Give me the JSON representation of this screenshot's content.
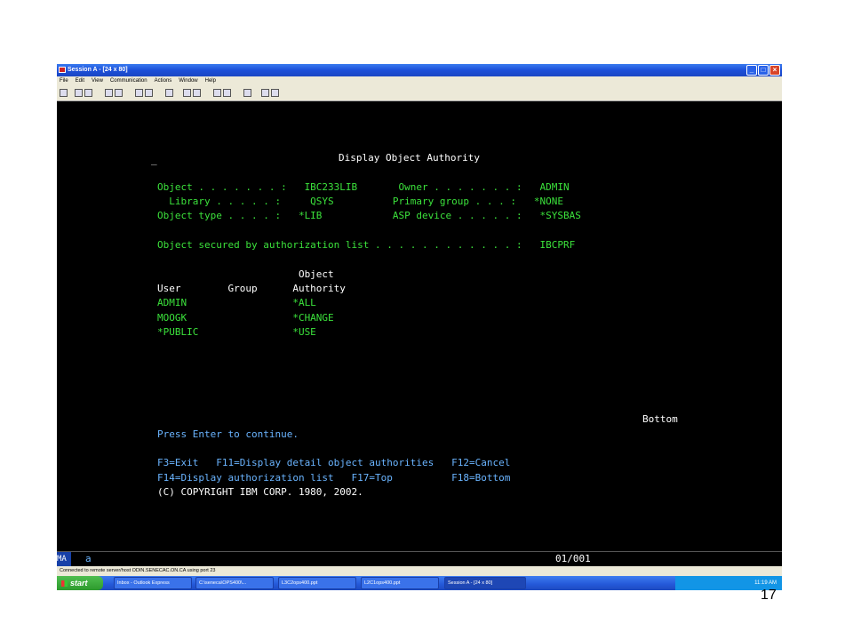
{
  "window": {
    "title": "Session A - [24 x 80]",
    "controls": [
      "minimize",
      "maximize",
      "close"
    ]
  },
  "menu": [
    "File",
    "Edit",
    "View",
    "Communication",
    "Actions",
    "Window",
    "Help"
  ],
  "toolbar_icons": [
    "print-screen-icon",
    "copy-icon",
    "paste-icon",
    "send-icon",
    "receive-icon",
    "display-icon",
    "keyboard-icon",
    "macro-icon",
    "record-icon",
    "play-icon",
    "stop-icon",
    "color-icon",
    "support-icon",
    "cursor-icon",
    "clear-icon"
  ],
  "terminal": {
    "cursor": "_",
    "heading": "Display Object Authority",
    "line_object": "Object . . . . . . . :   IBC233LIB       Owner . . . . . . . :   ADMIN",
    "line_library": "  Library . . . . . :     QSYS          Primary group . . . :   *NONE",
    "line_objtype": "Object type . . . . :   *LIB            ASP device . . . . . :   *SYSBAS",
    "line_secured": "Object secured by authorization list . . . . . . . . . . . . :   IBCPRF",
    "col_header1": "                        Object",
    "col_header2": "User        Group      Authority",
    "rows": [
      "ADMIN                  *ALL",
      "MOOGK                  *CHANGE",
      "*PUBLIC                *USE"
    ],
    "bottom": "Bottom",
    "press_enter": "Press Enter to continue.",
    "keys1": "F3=Exit   F11=Display detail object authorities   F12=Cancel",
    "keys2": "F14=Display authorization list   F17=Top          F18=Bottom",
    "copyright": "(C) COPYRIGHT IBM CORP. 1980, 2002."
  },
  "status": {
    "indicator": "MA",
    "mode": "a",
    "position": "01/001",
    "connection": "Connected to remote server/host ODIN.SENECAC.ON.CA using port 23"
  },
  "taskbar": {
    "start": "start",
    "tasks": [
      "Inbox - Outlook Express",
      "C:\\seneca\\OPS400\\...",
      "L3C2ops400.ppt",
      "L2C1ops400.ppt",
      "Session A - [24 x 80]"
    ],
    "clock": "11:19 AM"
  },
  "slide_number": "17"
}
